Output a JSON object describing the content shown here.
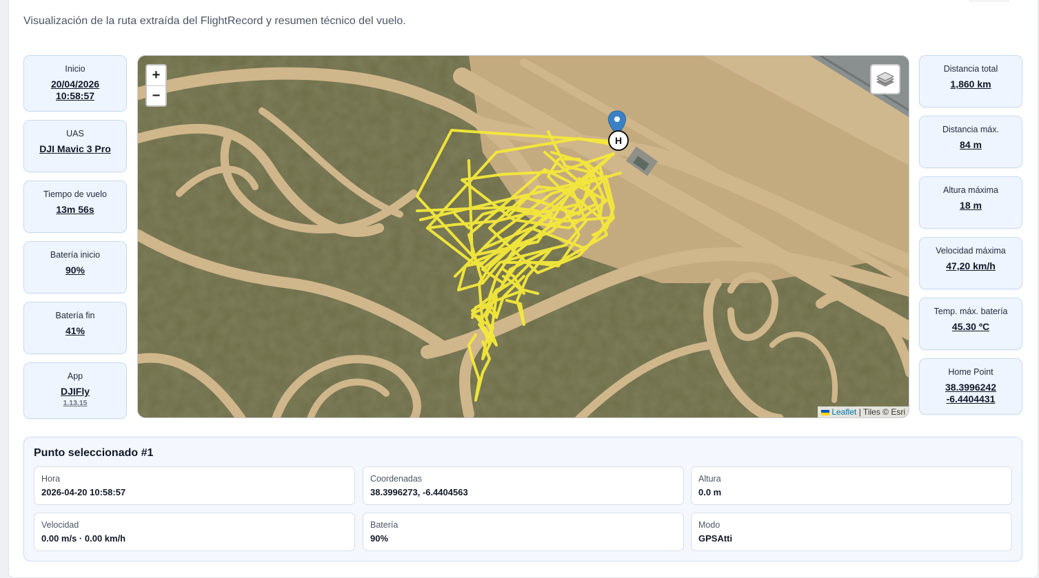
{
  "header": {
    "subtitle": "Visualización de la ruta extraída del FlightRecord y resumen técnico del vuelo."
  },
  "left_stats": [
    {
      "label": "Inicio",
      "value": "20/04/2026",
      "value2": "10:58:57"
    },
    {
      "label": "UAS",
      "value": "DJI Mavic 3 Pro"
    },
    {
      "label": "Tiempo de vuelo",
      "value": "13m 56s"
    },
    {
      "label": "Batería inicio",
      "value": "90%"
    },
    {
      "label": "Batería fin",
      "value": "41%"
    },
    {
      "label": "App",
      "value": "DJIFly",
      "sub": "1.13.15"
    }
  ],
  "right_stats": [
    {
      "label": "Distancia total",
      "value": "1,860 km"
    },
    {
      "label": "Distancia máx.",
      "value": "84 m"
    },
    {
      "label": "Altura máxima",
      "value": "18 m"
    },
    {
      "label": "Velocidad máxima",
      "value": "47,20 km/h"
    },
    {
      "label": "Temp. máx. batería",
      "value": "45.30 ºC"
    },
    {
      "label": "Home Point",
      "value": "38.3996242",
      "value2": "-6.4404431"
    }
  ],
  "map": {
    "zoom_in": "+",
    "zoom_out": "−",
    "home_marker": "H",
    "layers_icon": "layers-icon",
    "route_color": "#f5e93a",
    "attribution_link": "Leaflet",
    "attribution_text": " | Tiles © Esri"
  },
  "selected_point": {
    "title": "Punto seleccionado #1",
    "fields": [
      {
        "label": "Hora",
        "value": "2026-04-20 10:58:57"
      },
      {
        "label": "Coordenadas",
        "value": "38.3996273, -6.4404563"
      },
      {
        "label": "Altura",
        "value": "0.0 m"
      },
      {
        "label": "Velocidad",
        "value": "0.00 m/s · 0.00 km/h"
      },
      {
        "label": "Batería",
        "value": "90%"
      },
      {
        "label": "Modo",
        "value": "GPSAtti"
      }
    ]
  },
  "colors": {
    "card_bg": "#eef5ff",
    "card_border": "#c8dbf3",
    "marker_blue": "#3b82c4"
  }
}
